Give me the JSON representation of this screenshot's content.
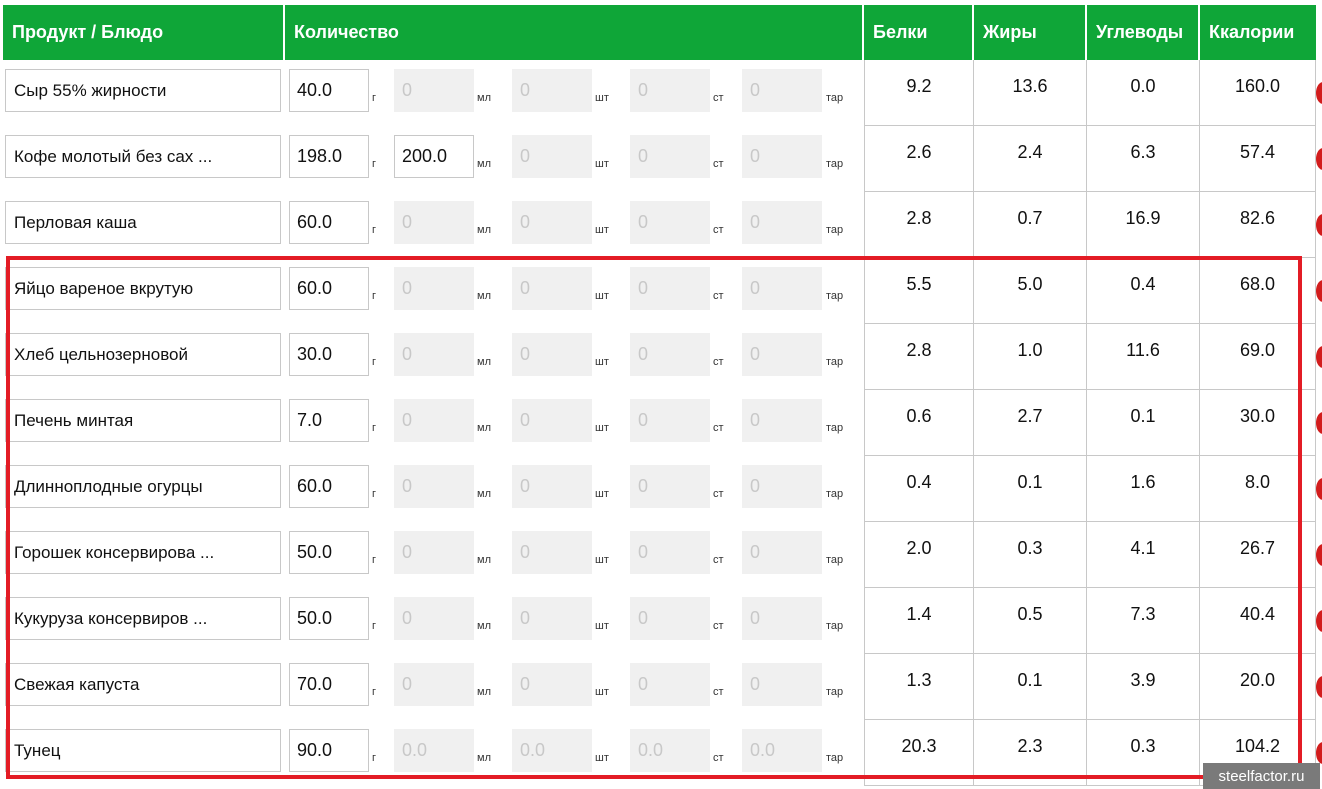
{
  "headers": {
    "product": "Продукт / Блюдо",
    "quantity": "Количество",
    "protein": "Белки",
    "fat": "Жиры",
    "carbs": "Углеводы",
    "kcal": "Ккалории"
  },
  "units": {
    "g": "г",
    "ml": "мл",
    "pcs": "шт",
    "st": "ст",
    "tar": "тар"
  },
  "rows": [
    {
      "name": "Сыр 55% жирности",
      "g": "40.0",
      "ml": "0",
      "pcs": "0",
      "st": "0",
      "tar": "0",
      "protein": "9.2",
      "fat": "13.6",
      "carbs": "0.0",
      "kcal": "160.0"
    },
    {
      "name": "Кофе молотый без сах ...",
      "g": "198.0",
      "ml": "200.0",
      "pcs": "0",
      "st": "0",
      "tar": "0",
      "protein": "2.6",
      "fat": "2.4",
      "carbs": "6.3",
      "kcal": "57.4"
    },
    {
      "name": "Перловая каша",
      "g": "60.0",
      "ml": "0",
      "pcs": "0",
      "st": "0",
      "tar": "0",
      "protein": "2.8",
      "fat": "0.7",
      "carbs": "16.9",
      "kcal": "82.6"
    },
    {
      "name": "Яйцо вареное вкрутую",
      "g": "60.0",
      "ml": "0",
      "pcs": "0",
      "st": "0",
      "tar": "0",
      "protein": "5.5",
      "fat": "5.0",
      "carbs": "0.4",
      "kcal": "68.0"
    },
    {
      "name": "Хлеб цельнозерновой",
      "g": "30.0",
      "ml": "0",
      "pcs": "0",
      "st": "0",
      "tar": "0",
      "protein": "2.8",
      "fat": "1.0",
      "carbs": "11.6",
      "kcal": "69.0"
    },
    {
      "name": "Печень минтая",
      "g": "7.0",
      "ml": "0",
      "pcs": "0",
      "st": "0",
      "tar": "0",
      "protein": "0.6",
      "fat": "2.7",
      "carbs": "0.1",
      "kcal": "30.0"
    },
    {
      "name": "Длинноплодные огурцы",
      "g": "60.0",
      "ml": "0",
      "pcs": "0",
      "st": "0",
      "tar": "0",
      "protein": "0.4",
      "fat": "0.1",
      "carbs": "1.6",
      "kcal": "8.0"
    },
    {
      "name": "Горошек консервирова ...",
      "g": "50.0",
      "ml": "0",
      "pcs": "0",
      "st": "0",
      "tar": "0",
      "protein": "2.0",
      "fat": "0.3",
      "carbs": "4.1",
      "kcal": "26.7"
    },
    {
      "name": "Кукуруза консервиров ...",
      "g": "50.0",
      "ml": "0",
      "pcs": "0",
      "st": "0",
      "tar": "0",
      "protein": "1.4",
      "fat": "0.5",
      "carbs": "7.3",
      "kcal": "40.4"
    },
    {
      "name": "Свежая капуста",
      "g": "70.0",
      "ml": "0",
      "pcs": "0",
      "st": "0",
      "tar": "0",
      "protein": "1.3",
      "fat": "0.1",
      "carbs": "3.9",
      "kcal": "20.0"
    },
    {
      "name": "Тунец",
      "g": "90.0",
      "ml": "0.0",
      "pcs": "0.0",
      "st": "0.0",
      "tar": "0.0",
      "protein": "20.3",
      "fat": "2.3",
      "carbs": "0.3",
      "kcal": "104.2"
    }
  ],
  "watermark": "steelfactor.ru",
  "colors": {
    "header": "#0fa638",
    "highlight": "#e31c25",
    "delete": "#d21d1d"
  }
}
